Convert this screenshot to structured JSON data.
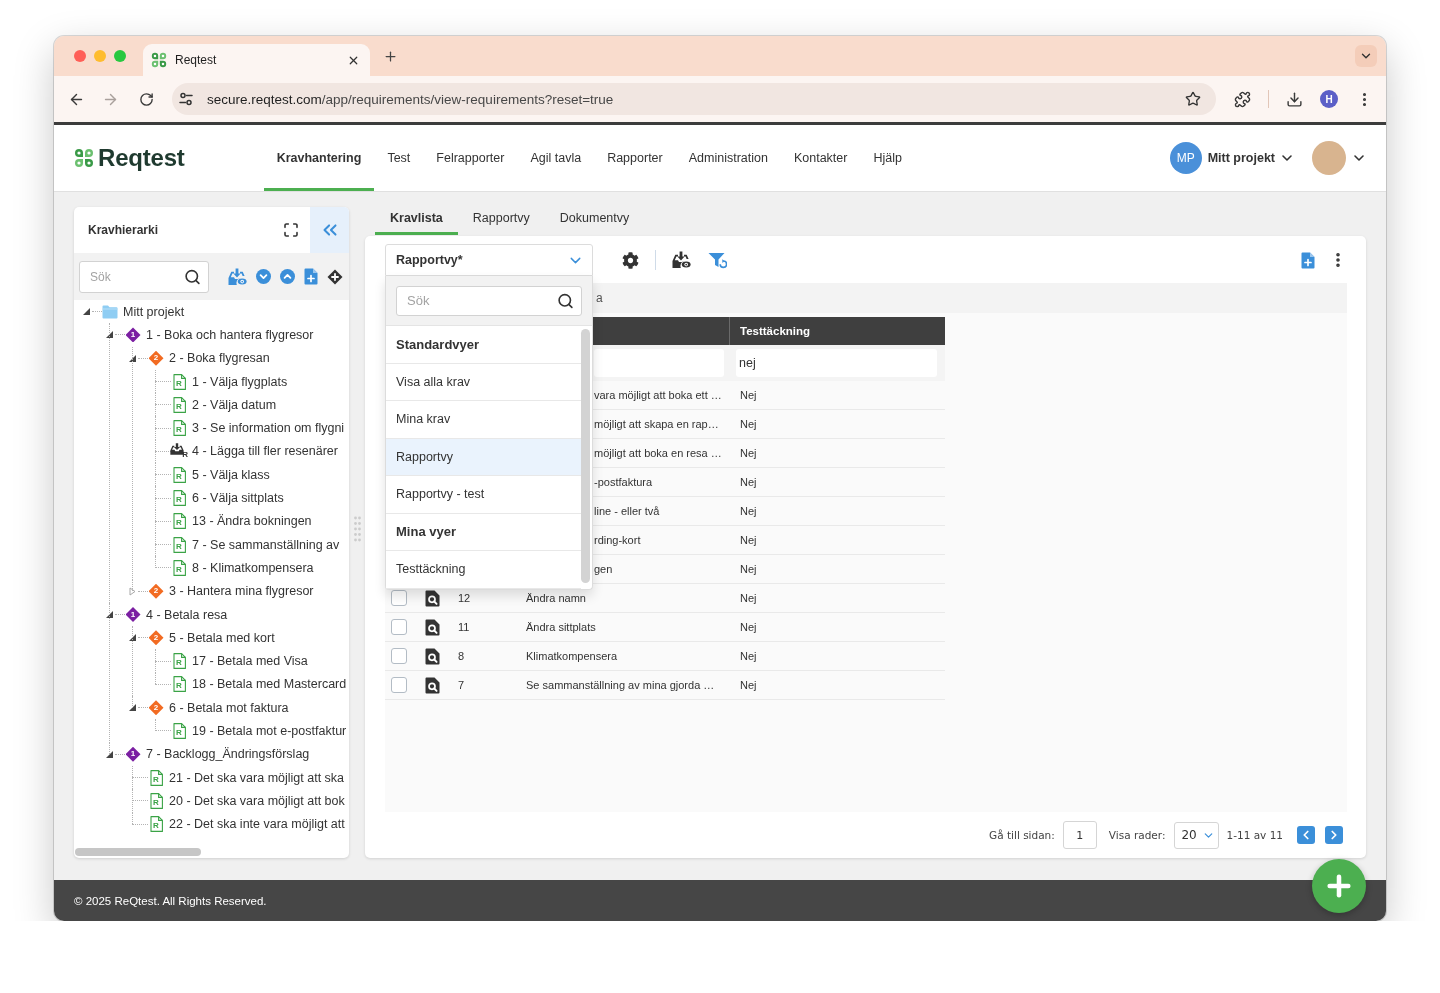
{
  "browser": {
    "tab": {
      "title": "Reqtest"
    },
    "url": {
      "domain": "secure.reqtest.com",
      "path": "/app/requirements/view-requirements?reset=true"
    },
    "profile": {
      "initial": "H"
    }
  },
  "header": {
    "logo": "Reqtest",
    "nav": [
      {
        "label": "Kravhantering",
        "selected": true
      },
      {
        "label": "Test",
        "selected": false
      },
      {
        "label": "Felrapporter",
        "selected": false
      },
      {
        "label": "Agil tavla",
        "selected": false
      },
      {
        "label": "Rapporter",
        "selected": false
      },
      {
        "label": "Administration",
        "selected": false
      },
      {
        "label": "Kontakter",
        "selected": false
      },
      {
        "label": "Hjälp",
        "selected": false
      }
    ],
    "project": {
      "initials": "MP",
      "name": "Mitt projekt"
    }
  },
  "hierarchy": {
    "title": "Kravhierarki",
    "search": {
      "placeholder": "Sök"
    },
    "tree": [
      {
        "label": "Mitt projekt",
        "kind": "folder",
        "expanded": true,
        "children": [
          {
            "label": "1 - Boka och hantera flygresor",
            "kind": "group",
            "badge": "1",
            "color": "#7b1fa2",
            "expanded": true,
            "children": [
              {
                "label": "2 - Boka flygresan",
                "kind": "group",
                "badge": "2",
                "color": "#f26b22",
                "expanded": true,
                "children": [
                  {
                    "label": "1 - Välja flygplats",
                    "kind": "requirement",
                    "badge": "R"
                  },
                  {
                    "label": "2 - Välja datum",
                    "kind": "requirement",
                    "badge": "R"
                  },
                  {
                    "label": "3 - Se information om flygni",
                    "kind": "requirement",
                    "badge": "R"
                  },
                  {
                    "label": "4 - Lägga till fler resenärer",
                    "kind": "tray",
                    "badge": "R"
                  },
                  {
                    "label": "5 - Välja klass",
                    "kind": "requirement",
                    "badge": "R"
                  },
                  {
                    "label": "6 - Välja sittplats",
                    "kind": "requirement",
                    "badge": "R"
                  },
                  {
                    "label": "13 - Ändra bokningen",
                    "kind": "requirement",
                    "badge": "R"
                  },
                  {
                    "label": "7 - Se sammanställning av",
                    "kind": "requirement",
                    "badge": "R"
                  },
                  {
                    "label": "8 - Klimatkompensera",
                    "kind": "requirement",
                    "badge": "R"
                  }
                ]
              },
              {
                "label": "3 - Hantera mina flygresor",
                "kind": "group",
                "badge": "2",
                "color": "#f26b22",
                "expanded": false
              }
            ]
          },
          {
            "label": "4 - Betala resa",
            "kind": "group",
            "badge": "1",
            "color": "#7b1fa2",
            "expanded": true,
            "children": [
              {
                "label": "5 - Betala med kort",
                "kind": "group",
                "badge": "2",
                "color": "#f26b22",
                "expanded": true,
                "children": [
                  {
                    "label": "17 - Betala med Visa",
                    "kind": "requirement",
                    "badge": "R"
                  },
                  {
                    "label": "18 - Betala med Mastercard",
                    "kind": "requirement",
                    "badge": "R"
                  }
                ]
              },
              {
                "label": "6 - Betala mot faktura",
                "kind": "group",
                "badge": "2",
                "color": "#f26b22",
                "expanded": true,
                "children": [
                  {
                    "label": "19 - Betala mot e-postfaktur",
                    "kind": "requirement",
                    "badge": "R"
                  }
                ]
              }
            ]
          },
          {
            "label": "7 - Backlogg_Ändringsförslag",
            "kind": "group",
            "badge": "1",
            "color": "#7b1fa2",
            "expanded": true,
            "children": [
              {
                "label": "21 - Det ska vara möjligt att ska",
                "kind": "requirement",
                "badge": "R"
              },
              {
                "label": "20 - Det ska vara möjligt att bok",
                "kind": "requirement",
                "badge": "R"
              },
              {
                "label": "22 - Det ska inte vara möjligt att",
                "kind": "requirement",
                "badge": "R"
              }
            ]
          }
        ]
      }
    ]
  },
  "main": {
    "tabs": [
      {
        "label": "Kravlista",
        "selected": true
      },
      {
        "label": "Rapportvy",
        "selected": false
      },
      {
        "label": "Dokumentvy",
        "selected": false
      }
    ],
    "view_select": {
      "value": "Rapportvy*",
      "expanded": true,
      "search": {
        "placeholder": "Sök"
      },
      "options": [
        {
          "kind": "group",
          "label": "Standardvyer"
        },
        {
          "kind": "option",
          "label": "Visa alla krav",
          "selected": false
        },
        {
          "kind": "option",
          "label": "Mina krav",
          "selected": false
        },
        {
          "kind": "option",
          "label": "Rapportvy",
          "selected": true
        },
        {
          "kind": "option",
          "label": "Rapportvy - test",
          "selected": false
        },
        {
          "kind": "group",
          "label": "Mina vyer"
        },
        {
          "kind": "option",
          "label": "Testtäckning",
          "selected": false
        }
      ]
    },
    "group_bar": {
      "text": "a"
    },
    "table": {
      "columns": [
        {
          "label": "Testtäckning"
        }
      ],
      "filter": {
        "value": "nej"
      },
      "rows": [
        {
          "title": "vara möjligt att boka ett …",
          "coverage": "Nej"
        },
        {
          "title": "möjligt att skapa en rap…",
          "coverage": "Nej"
        },
        {
          "title": "möjligt att boka en resa …",
          "coverage": "Nej"
        },
        {
          "title": "-postfaktura",
          "coverage": "Nej"
        },
        {
          "title": "line - eller två",
          "coverage": "Nej"
        },
        {
          "title": "rding-kort",
          "coverage": "Nej"
        },
        {
          "title": "gen",
          "coverage": "Nej"
        },
        {
          "checked": false,
          "id": "12",
          "title": "Ändra namn",
          "coverage": "Nej"
        },
        {
          "checked": false,
          "id": "11",
          "title": "Ändra sittplats",
          "coverage": "Nej"
        },
        {
          "checked": false,
          "id": "8",
          "title": "Klimatkompensera",
          "coverage": "Nej"
        },
        {
          "checked": false,
          "id": "7",
          "title": "Se sammanställning av mina gjorda …",
          "coverage": "Nej"
        }
      ]
    },
    "pagination": {
      "goto_label": "Gå till sidan:",
      "page": "1",
      "rows_label": "Visa rader:",
      "rows_per_page": "20",
      "range": "1-11 av 11"
    }
  },
  "footer": {
    "text": "© 2025 ReQtest. All Rights Reserved."
  }
}
